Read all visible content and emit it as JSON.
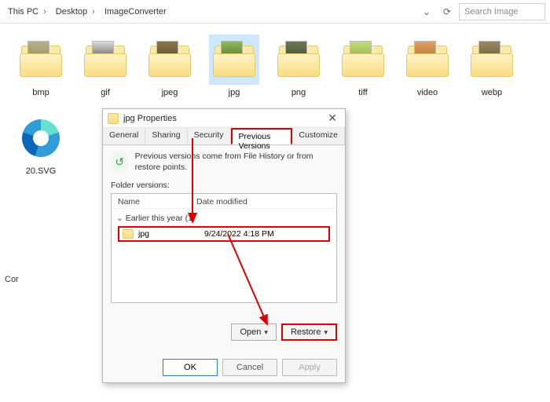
{
  "breadcrumb": {
    "p0": "This PC",
    "p1": "Desktop",
    "p2": "ImageConverter"
  },
  "search_placeholder": "Search Image",
  "folders": [
    {
      "label": "bmp",
      "preview": "#a8a070"
    },
    {
      "label": "gif",
      "preview": "#2c2c2c"
    },
    {
      "label": "jpeg",
      "preview": "#6b5a38"
    },
    {
      "label": "jpg",
      "preview": "#5f8c3a"
    },
    {
      "label": "png",
      "preview": "#4a5a3a"
    },
    {
      "label": "tiff",
      "preview": "#9fc24c"
    },
    {
      "label": "video",
      "preview": "#c4864a"
    },
    {
      "label": "webp",
      "preview": "#7a6a4a"
    }
  ],
  "edge_file": "20.SVG",
  "cor_label": "Cor",
  "dialog": {
    "title": "jpg Properties",
    "tabs": {
      "general": "General",
      "sharing": "Sharing",
      "security": "Security",
      "pv": "Previous Versions",
      "customize": "Customize"
    },
    "pv_hint": "Previous versions come from File History or from restore points.",
    "fv_label": "Folder versions:",
    "col_name": "Name",
    "col_date": "Date modified",
    "group_hdr": "Earlier this year (1)",
    "row_name": "jpg",
    "row_date": "9/24/2022 4:18 PM",
    "open_label": "Open",
    "restore_label": "Restore",
    "ok_label": "OK",
    "cancel_label": "Cancel",
    "apply_label": "Apply"
  }
}
